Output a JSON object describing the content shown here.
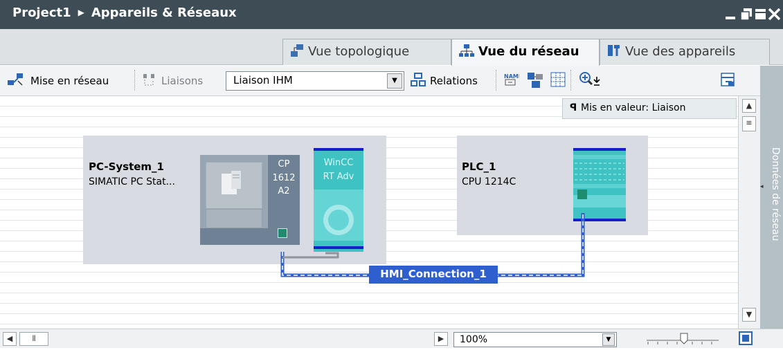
{
  "window": {
    "project": "Project1",
    "title": "Appareils & Réseaux"
  },
  "tabs": [
    {
      "label": "Vue topologique",
      "icon": "topology-view-icon"
    },
    {
      "label": "Vue du réseau",
      "icon": "network-view-icon"
    },
    {
      "label": "Vue des appareils",
      "icon": "device-view-icon"
    }
  ],
  "toolbar": {
    "network_label": "Mise en réseau",
    "connections_label": "Liaisons",
    "connection_type": "Liaison IHM",
    "relations_label": "Relations"
  },
  "tooltip": "Mis en valeur: Liaison",
  "devices": {
    "pc": {
      "name": "PC-System_1",
      "type": "SIMATIC PC Stat...",
      "cp_label_1": "CP",
      "cp_label_2": "1612",
      "cp_label_3": "A2",
      "wincc_label_1": "WinCC",
      "wincc_label_2": "RT Adv"
    },
    "plc": {
      "name": "PLC_1",
      "type": "CPU 1214C"
    }
  },
  "connection": {
    "name": "HMI_Connection_1"
  },
  "sidepanel": {
    "label": "Données de réseau"
  },
  "bottom": {
    "zoom": "100%"
  },
  "colors": {
    "titlebar": "#3e4c56",
    "connection": "#2f5fcf",
    "plc_teal": "#3fc2c2",
    "port_green": "#1e8c6e"
  }
}
